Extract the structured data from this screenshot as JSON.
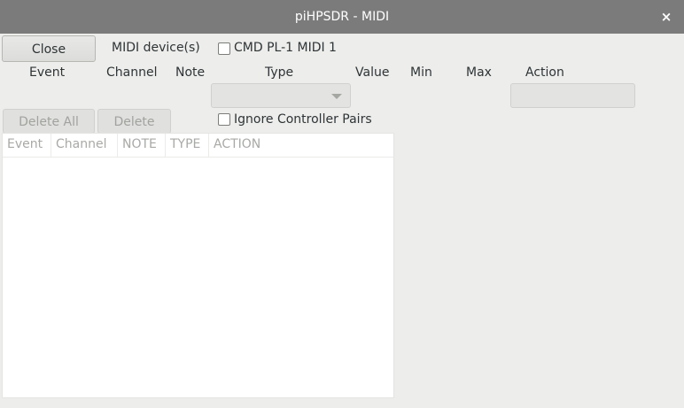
{
  "window": {
    "title": "piHPSDR - MIDI",
    "close_glyph": "×"
  },
  "toolbar": {
    "close_label": "Close",
    "midi_devices_label": "MIDI device(s)",
    "device_name": "CMD PL-1 MIDI 1",
    "device_checked": false
  },
  "fields": {
    "event_label": "Event",
    "channel_label": "Channel",
    "note_label": "Note",
    "type_label": "Type",
    "value_label": "Value",
    "min_label": "Min",
    "max_label": "Max",
    "action_label": "Action",
    "type_value": "",
    "action_value": ""
  },
  "actions": {
    "delete_all_label": "Delete All",
    "delete_label": "Delete",
    "ignore_pairs_label": "Ignore Controller Pairs",
    "ignore_pairs_checked": false
  },
  "table": {
    "columns": [
      "Event",
      "Channel",
      "NOTE",
      "TYPE",
      "ACTION"
    ],
    "rows": []
  },
  "colors": {
    "titlebar": "#7b7b7b",
    "window_bg": "#ededeb",
    "disabled_text": "#a0a39e"
  }
}
